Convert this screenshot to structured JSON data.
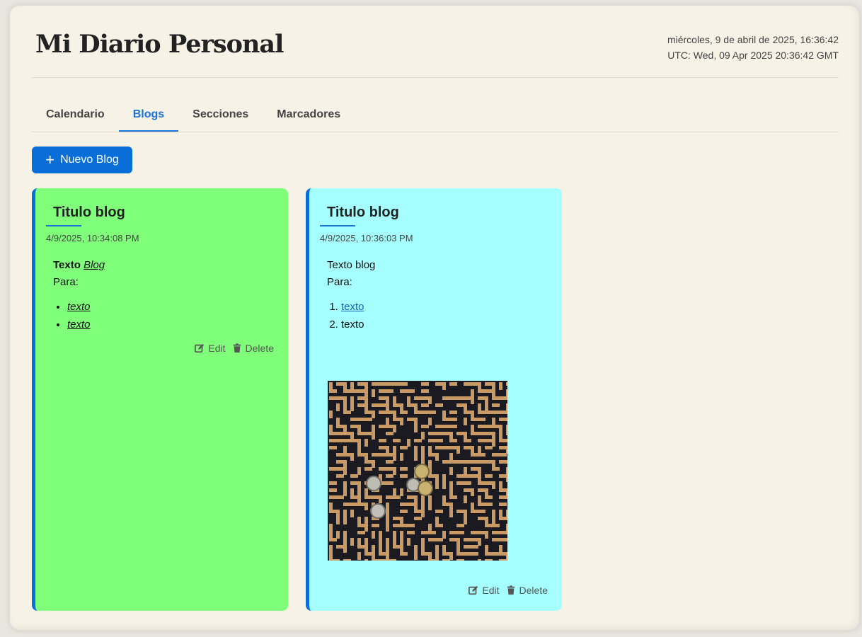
{
  "header": {
    "title": "Mi Diario Personal",
    "local_datetime": "miércoles, 9 de abril de 2025, 16:36:42",
    "utc_datetime": "UTC: Wed, 09 Apr 2025 20:36:42 GMT"
  },
  "tabs": [
    {
      "label": "Calendario",
      "active": false
    },
    {
      "label": "Blogs",
      "active": true
    },
    {
      "label": "Secciones",
      "active": false
    },
    {
      "label": "Marcadores",
      "active": false
    }
  ],
  "toolbar": {
    "new_label": "Nuevo Blog",
    "new_icon": "plus-icon"
  },
  "blogs": [
    {
      "title": "Titulo blog",
      "date": "4/9/2025, 10:34:08 PM",
      "color": "#80ff7a",
      "body": {
        "line1_bold": "Texto",
        "line1_italic": "Blog",
        "line2": "Para:",
        "list_type": "bulleted",
        "list": [
          "texto",
          "texto"
        ]
      },
      "actions": {
        "edit": "Edit",
        "delete": "Delete"
      }
    },
    {
      "title": "Titulo blog",
      "date": "4/9/2025, 10:36:03 PM",
      "color": "#a5fffe",
      "body": {
        "line1": "Texto blog",
        "line2": "Para:",
        "list_type": "numbered",
        "list": [
          "texto",
          "texto"
        ],
        "image": "maze-with-coins-photo"
      },
      "actions": {
        "edit": "Edit",
        "delete": "Delete"
      }
    }
  ],
  "colors": {
    "accent": "#0a6ed8",
    "background": "#f7f2e6"
  }
}
